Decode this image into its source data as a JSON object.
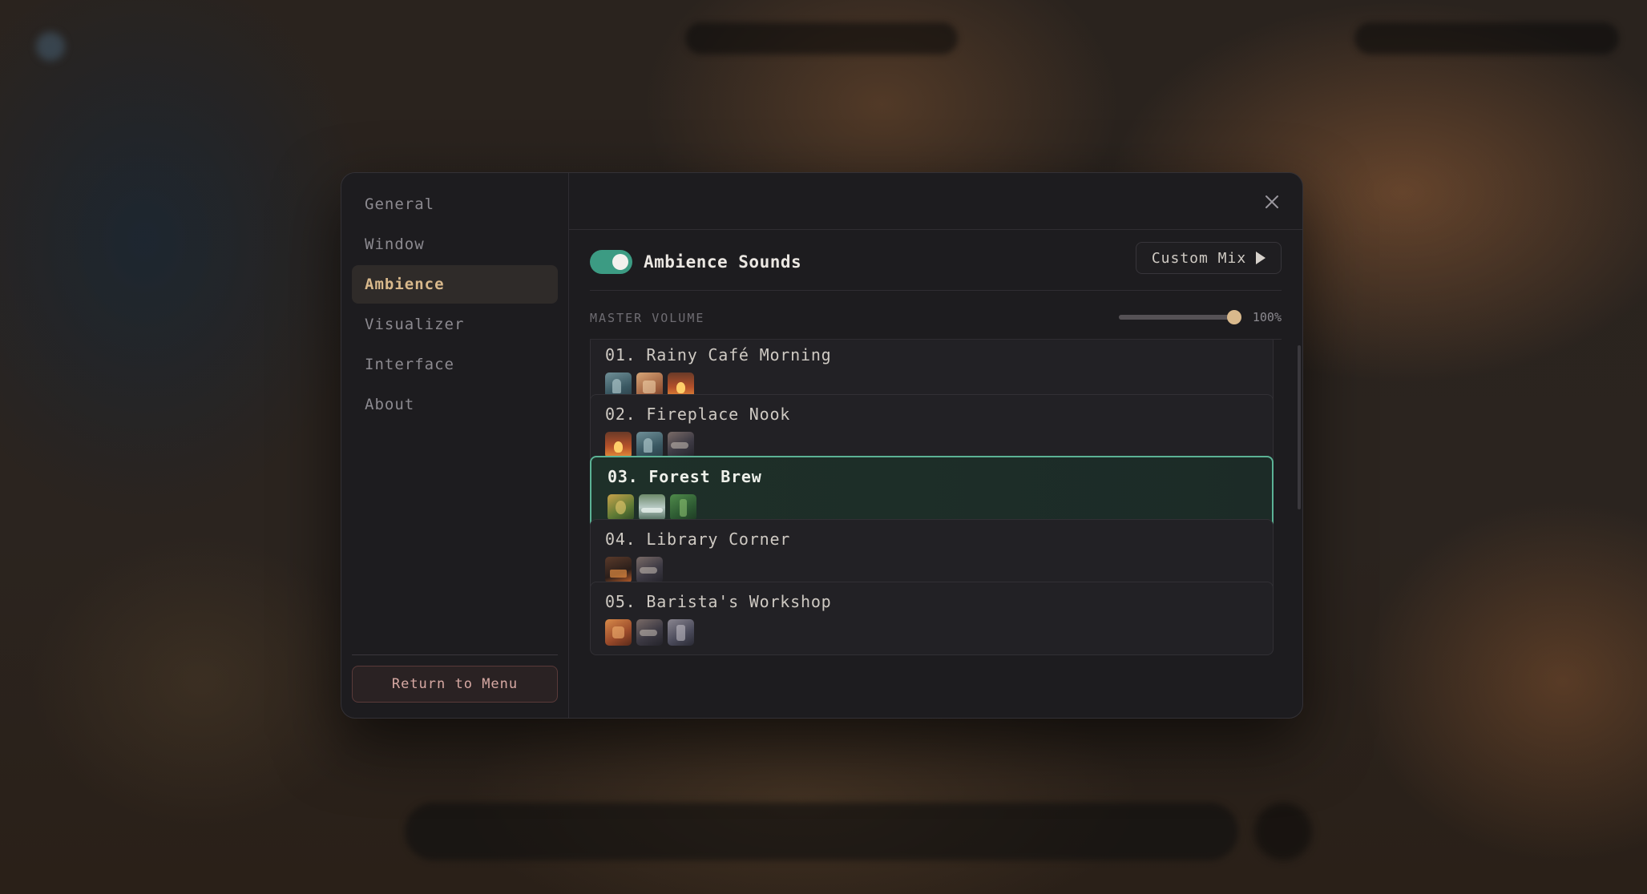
{
  "sidebar": {
    "items": [
      {
        "label": "General",
        "active": false
      },
      {
        "label": "Window",
        "active": false
      },
      {
        "label": "Ambience",
        "active": true
      },
      {
        "label": "Visualizer",
        "active": false
      },
      {
        "label": "Interface",
        "active": false
      },
      {
        "label": "About",
        "active": false
      }
    ],
    "return_label": "Return to Menu"
  },
  "ambience": {
    "toggle_on": true,
    "toggle_label": "Ambience Sounds",
    "custom_mix_label": "Custom Mix",
    "volume_label": "MASTER VOLUME",
    "volume_fraction": 1.0,
    "volume_value": "100%"
  },
  "presets": [
    {
      "title": "01. Rainy Café Morning",
      "active": false,
      "icons": [
        "rain-icon",
        "cafe-icon",
        "fireplace-icon"
      ]
    },
    {
      "title": "02. Fireplace Nook",
      "active": false,
      "icons": [
        "fireplace-icon",
        "rain-icon",
        "wind-icon"
      ]
    },
    {
      "title": "03. Forest Brew",
      "active": true,
      "icons": [
        "leaves-icon",
        "stream-icon",
        "forest-icon"
      ]
    },
    {
      "title": "04. Library Corner",
      "active": false,
      "icons": [
        "book-icon",
        "wind-icon"
      ]
    },
    {
      "title": "05. Barista's Workshop",
      "active": false,
      "icons": [
        "espresso-machine-icon",
        "wind-icon",
        "grinder-icon"
      ]
    }
  ],
  "colors": {
    "accent_green": "#3c9b83",
    "active_border": "#5bb295",
    "accent_gold": "#d9b98c",
    "return_red": "#d7a9a3"
  }
}
